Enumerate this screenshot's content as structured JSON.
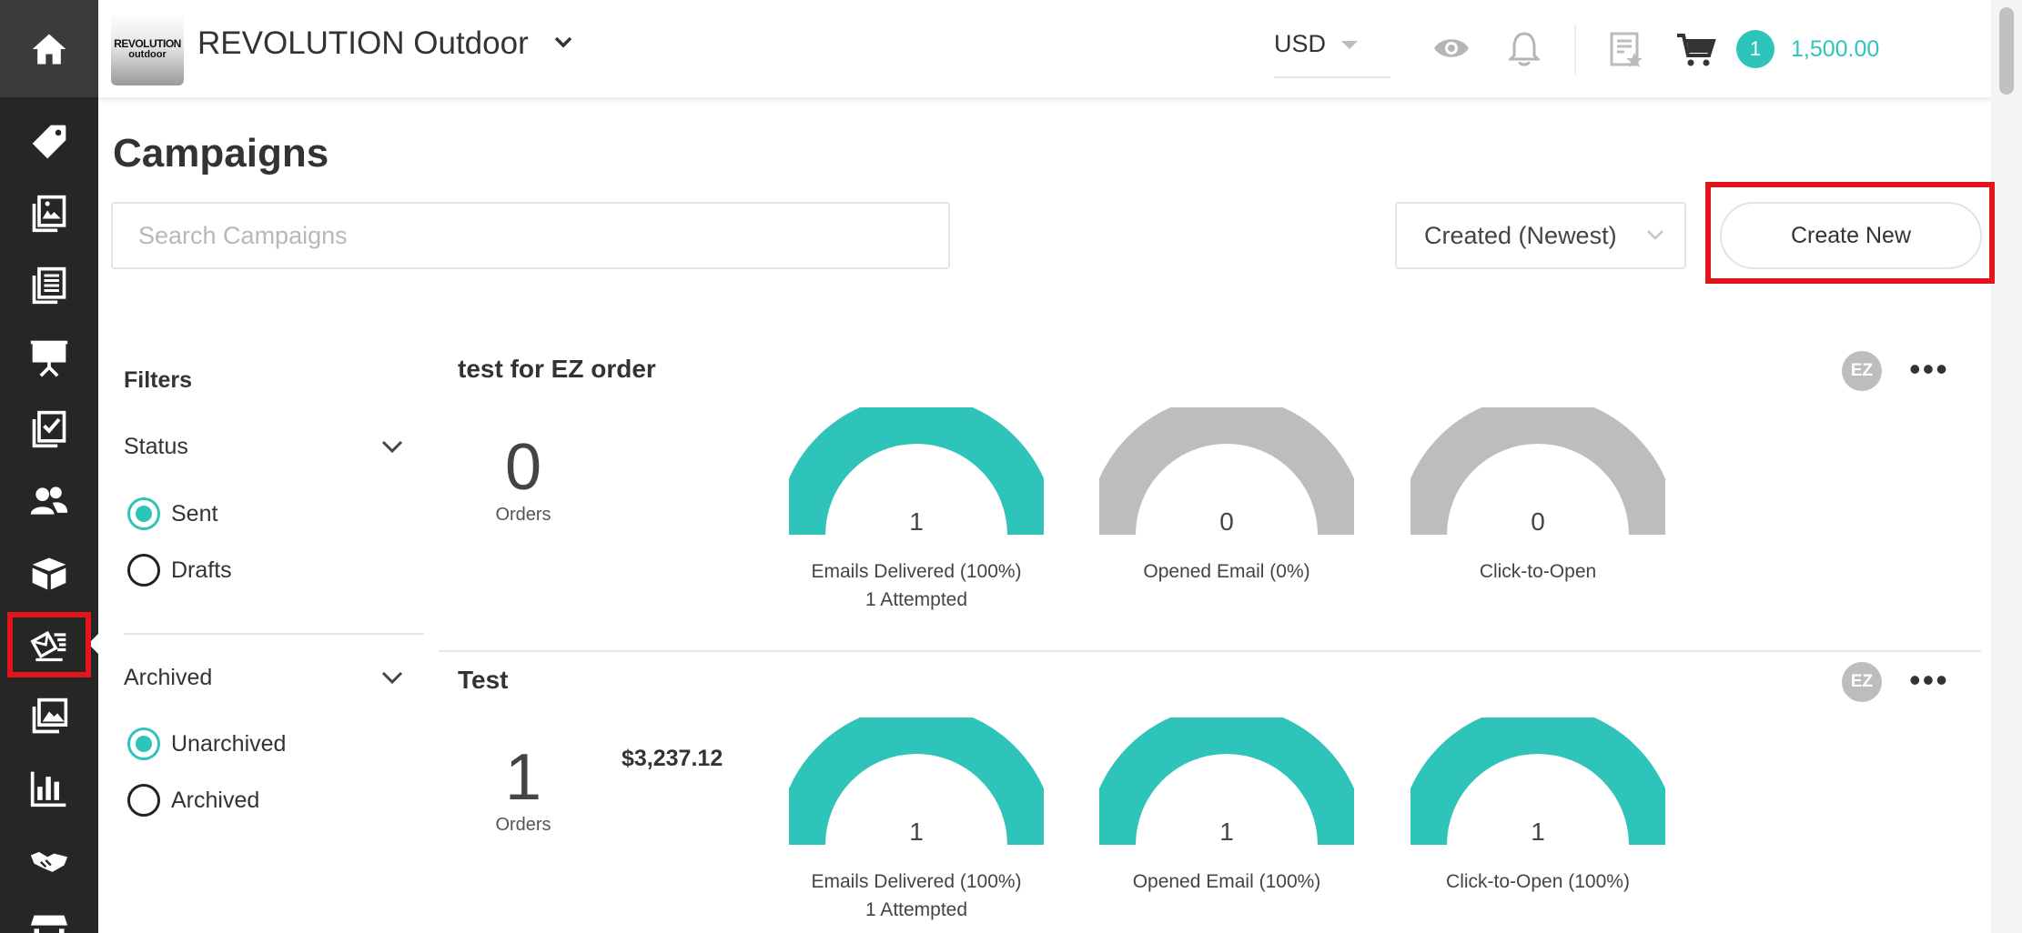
{
  "header": {
    "brand_name": "REVOLUTION Outdoor",
    "logo_line1": "REVOLUTION",
    "logo_line2": "outdoor",
    "currency": "USD",
    "cart_count": "1",
    "balance": "1,500.00"
  },
  "sidebar": {
    "items": [
      "home",
      "price-tag",
      "catalog",
      "price-list",
      "presentation",
      "orders",
      "customers",
      "inventory",
      "campaigns",
      "media",
      "reports",
      "partners",
      "store"
    ],
    "active": "campaigns"
  },
  "page": {
    "title": "Campaigns",
    "search_placeholder": "Search Campaigns",
    "sort_label": "Created (Newest)",
    "create_label": "Create New"
  },
  "filters": {
    "title": "Filters",
    "status_label": "Status",
    "status_options": [
      "Sent",
      "Drafts"
    ],
    "status_selected": "Sent",
    "archived_label": "Archived",
    "archived_options": [
      "Unarchived",
      "Archived"
    ],
    "archived_selected": "Unarchived"
  },
  "campaigns": [
    {
      "title": "test for EZ order",
      "avatar": "EZ",
      "menu": "•••",
      "orders": "0",
      "orders_label": "Orders",
      "revenue": "",
      "metrics": [
        {
          "value": "1",
          "label": "Emails Delivered (100%)",
          "sublabel": "1 Attempted",
          "fill": 1.0
        },
        {
          "value": "0",
          "label": "Opened Email (0%)",
          "sublabel": "",
          "fill": 0.0
        },
        {
          "value": "0",
          "label": "Click-to-Open",
          "sublabel": "",
          "fill": 0.0
        }
      ]
    },
    {
      "title": "Test",
      "avatar": "EZ",
      "menu": "•••",
      "orders": "1",
      "orders_label": "Orders",
      "revenue": "$3,237.12",
      "metrics": [
        {
          "value": "1",
          "label": "Emails Delivered (100%)",
          "sublabel": "1 Attempted",
          "fill": 1.0
        },
        {
          "value": "1",
          "label": "Opened Email (100%)",
          "sublabel": "",
          "fill": 1.0
        },
        {
          "value": "1",
          "label": "Click-to-Open (100%)",
          "sublabel": "",
          "fill": 1.0
        }
      ]
    }
  ],
  "colors": {
    "accent": "#2fc4b9",
    "gauge_empty": "#bdbdbd",
    "sidebar_bg": "#262626",
    "highlight_box": "#e3141b"
  }
}
